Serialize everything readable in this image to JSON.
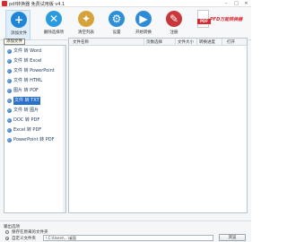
{
  "window": {
    "title": "pdf转换器 免费试用版 v4.1",
    "minimize": "–",
    "maximize": "□",
    "close": "✕"
  },
  "toolbar": {
    "buttons": [
      {
        "label": "添加文件",
        "icon": "add-file-icon",
        "glyph": "+",
        "color": "#1f86d6"
      },
      {
        "label": "删除选择项",
        "icon": "delete-selected-icon",
        "glyph": "✕",
        "color": "#2a9be0"
      },
      {
        "label": "清空列表",
        "icon": "broom-icon",
        "glyph": "✦",
        "color": "#d7a23a"
      },
      {
        "label": "设置",
        "icon": "gear-icon",
        "glyph": "⚙",
        "color": "#2d8fd8"
      },
      {
        "label": "开始转换",
        "icon": "play-icon",
        "glyph": "▶",
        "color": "#2e8bd6"
      },
      {
        "label": "注册",
        "icon": "register-icon",
        "glyph": "✎",
        "color": "#c9373a"
      }
    ],
    "tooltip": "添加文件"
  },
  "brand": {
    "doc_label": "PDF",
    "name": "PFD万能转换器",
    "accent": "#d9282f"
  },
  "sidebar": {
    "items": [
      {
        "label": "文件 转 Word"
      },
      {
        "label": "文件 转 Excel"
      },
      {
        "label": "文件 转 PowerPoint"
      },
      {
        "label": "文件 转 HTML"
      },
      {
        "label": "图片 转 PDF"
      },
      {
        "label": "文件 转 TXT"
      },
      {
        "label": "文件 转 图片"
      },
      {
        "label": "DOC 转 PDF"
      },
      {
        "label": "Excel 转 PDF"
      },
      {
        "label": "PowerPoint 转 PDF"
      }
    ],
    "selected_index": 5
  },
  "file_list": {
    "columns": [
      "文件名称",
      "页数选择",
      "文件大小",
      "转换进度",
      "打开"
    ]
  },
  "output": {
    "title": "输出选项",
    "option_original": "保存在原来的文件夹",
    "option_custom": "自定义文件夹",
    "path": "\\ C:\\Users\\…\\桌面",
    "browse": "浏览"
  }
}
